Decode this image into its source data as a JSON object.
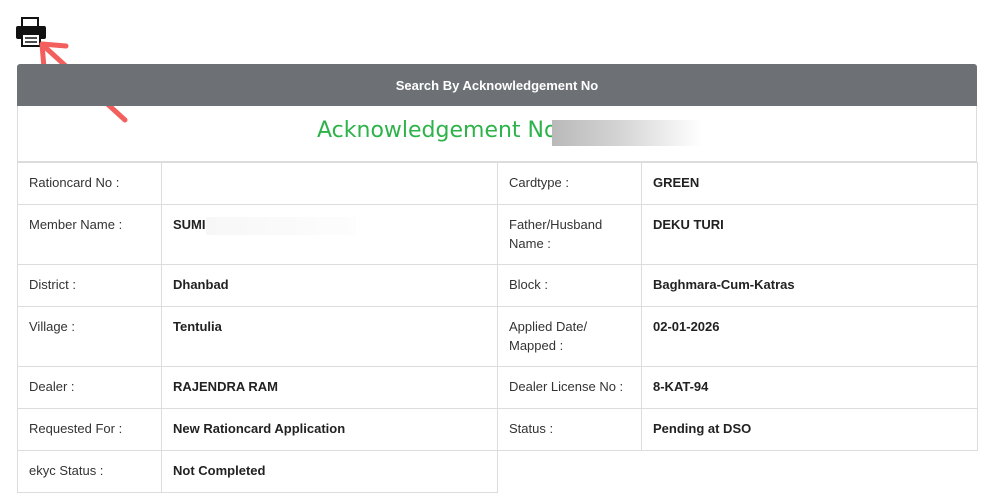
{
  "header": {
    "title": "Search By Acknowledgement No"
  },
  "acknowledgement": {
    "label": "Acknowledgement No :"
  },
  "rows": [
    {
      "l1": "Rationcard No :",
      "v1": "",
      "l2": "Cardtype :",
      "v2": "GREEN"
    },
    {
      "l1": "Member Name :",
      "v1": "SUMI",
      "l2": "Father/Husband Name :",
      "v2": "DEKU TURI"
    },
    {
      "l1": "District :",
      "v1": "Dhanbad",
      "l2": "Block :",
      "v2": "Baghmara-Cum-Katras"
    },
    {
      "l1": "Village :",
      "v1": "Tentulia",
      "l2": "Applied Date/ Mapped :",
      "v2": "02-01-2026"
    },
    {
      "l1": "Dealer :",
      "v1": "RAJENDRA RAM",
      "l2": "Dealer License No :",
      "v2": "8-KAT-94"
    },
    {
      "l1": "Requested For :",
      "v1": "New Rationcard Application",
      "l2": "Status :",
      "v2": "Pending at DSO"
    },
    {
      "l1": "ekyc Status :",
      "v1": "Not Completed"
    }
  ],
  "colors": {
    "header_bg": "#6d7176",
    "ack_green": "#2db34a",
    "status_green": "#198754",
    "arrow": "#f25f5c"
  },
  "icons": {
    "print": "printer-icon",
    "annotation": "arrow-annotation"
  }
}
